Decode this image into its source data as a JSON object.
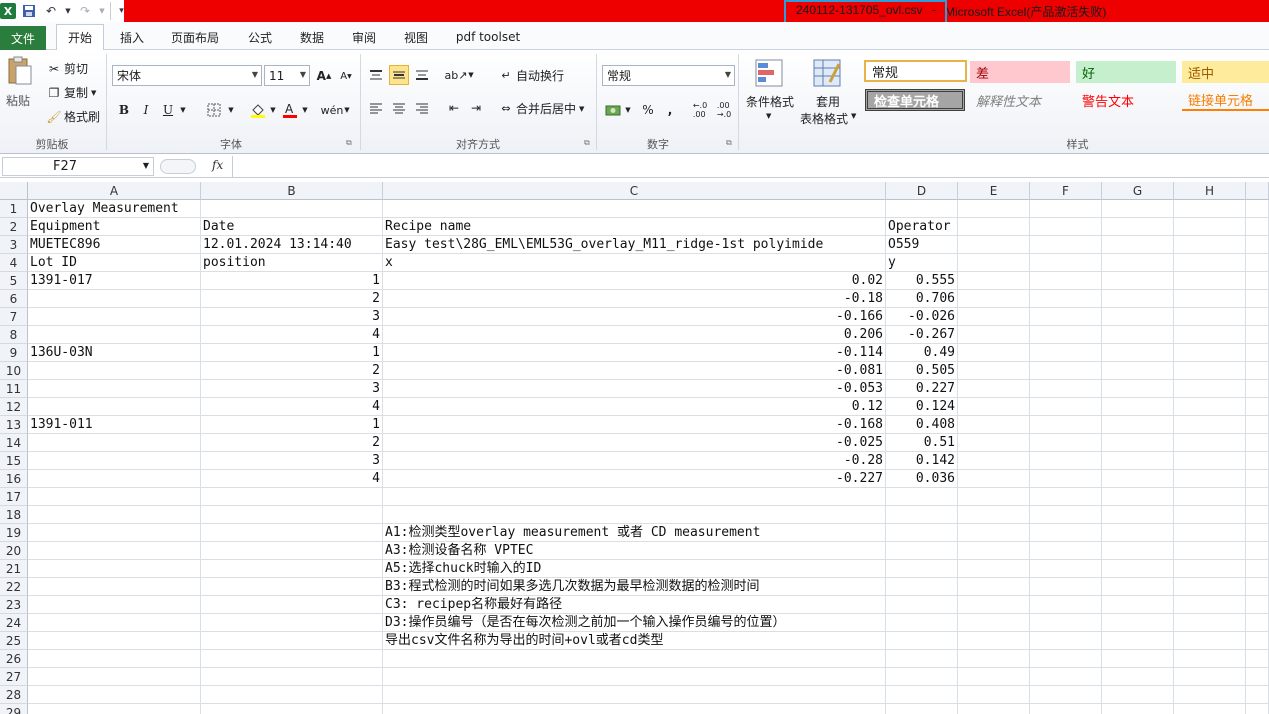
{
  "titlebar": {
    "file_name": "240112-131705_ovl.csv",
    "separator": "-",
    "app_name": "Microsoft Excel(产品激活失败)",
    "app_name_display": "Microsoft Excel(产品激活失败)",
    "qat_logo": "X"
  },
  "tabs": [
    "文件",
    "开始",
    "插入",
    "页面布局",
    "公式",
    "数据",
    "审阅",
    "视图",
    "pdf toolset"
  ],
  "ribbon": {
    "clipboard": {
      "paste": "粘贴",
      "cut": "剪切",
      "copy": "复制",
      "format_painter": "格式刷",
      "label": "剪贴板"
    },
    "font": {
      "name": "宋体",
      "size": "11",
      "bold": "B",
      "italic": "I",
      "underline": "U",
      "label": "字体"
    },
    "alignment": {
      "wrap": "自动换行",
      "merge": "合并后居中",
      "label": "对齐方式"
    },
    "number": {
      "format": "常规",
      "percent": "%",
      "comma": ",",
      "label": "数字"
    },
    "styles": {
      "conditional": "条件格式",
      "table_format_1": "套用",
      "table_format_2": "表格格式",
      "normal": "常规",
      "bad": "差",
      "good": "好",
      "neutral": "适中",
      "check_cell": "检查单元格",
      "explanatory": "解释性文本",
      "warning": "警告文本",
      "linked_cell": "链接单元格",
      "label": "样式"
    }
  },
  "formula_bar": {
    "name_box": "F27",
    "fx": "fx",
    "value": ""
  },
  "columns": [
    "A",
    "B",
    "C",
    "D",
    "E",
    "F",
    "G",
    "H"
  ],
  "rows": [
    {
      "n": "1",
      "A": "Overlay Measurement",
      "B": "",
      "C": "",
      "D": ""
    },
    {
      "n": "2",
      "A": "Equipment",
      "B": "Date",
      "C": "Recipe name",
      "D": "Operator"
    },
    {
      "n": "3",
      "A": "MUETEC896",
      "B": "12.01.2024  13:14:40",
      "C": "Easy test\\28G_EML\\EML53G_overlay_M11_ridge-1st polyimide",
      "D": "O559"
    },
    {
      "n": "4",
      "A": "Lot ID",
      "B": "position",
      "C": "x",
      "D": "y"
    },
    {
      "n": "5",
      "A": "1391-017",
      "B": "1",
      "C": "0.02",
      "D": "0.555"
    },
    {
      "n": "6",
      "A": "",
      "B": "2",
      "C": "-0.18",
      "D": "0.706"
    },
    {
      "n": "7",
      "A": "",
      "B": "3",
      "C": "-0.166",
      "D": "-0.026"
    },
    {
      "n": "8",
      "A": "",
      "B": "4",
      "C": "0.206",
      "D": "-0.267"
    },
    {
      "n": "9",
      "A": "136U-03N",
      "B": "1",
      "C": "-0.114",
      "D": "0.49"
    },
    {
      "n": "10",
      "A": "",
      "B": "2",
      "C": "-0.081",
      "D": "0.505"
    },
    {
      "n": "11",
      "A": "",
      "B": "3",
      "C": "-0.053",
      "D": "0.227"
    },
    {
      "n": "12",
      "A": "",
      "B": "4",
      "C": "0.12",
      "D": "0.124"
    },
    {
      "n": "13",
      "A": "1391-011",
      "B": "1",
      "C": "-0.168",
      "D": "0.408"
    },
    {
      "n": "14",
      "A": "",
      "B": "2",
      "C": "-0.025",
      "D": "0.51"
    },
    {
      "n": "15",
      "A": "",
      "B": "3",
      "C": "-0.28",
      "D": "0.142"
    },
    {
      "n": "16",
      "A": "",
      "B": "4",
      "C": "-0.227",
      "D": "0.036"
    },
    {
      "n": "17",
      "A": "",
      "B": "",
      "C": "",
      "D": ""
    },
    {
      "n": "18",
      "A": "",
      "B": "",
      "C": "",
      "D": ""
    },
    {
      "n": "19",
      "A": "",
      "B": "",
      "C": "A1:检测类型overlay measurement 或者 CD measurement",
      "D": ""
    },
    {
      "n": "20",
      "A": "",
      "B": "",
      "C": "A3:检测设备名称  VPTEC",
      "D": ""
    },
    {
      "n": "21",
      "A": "",
      "B": "",
      "C": "A5:选择chuck时输入的ID",
      "D": ""
    },
    {
      "n": "22",
      "A": "",
      "B": "",
      "C": "B3:程式检测的时间如果多选几次数据为最早检测数据的检测时间",
      "D": ""
    },
    {
      "n": "23",
      "A": "",
      "B": "",
      "C": "C3: recipep名称最好有路径",
      "D": ""
    },
    {
      "n": "24",
      "A": "",
      "B": "",
      "C": "D3:操作员编号（是否在每次检测之前加一个输入操作员编号的位置）",
      "D": ""
    },
    {
      "n": "25",
      "A": "",
      "B": "",
      "C": "导出csv文件名称为导出的时间+ovl或者cd类型",
      "D": ""
    },
    {
      "n": "26",
      "A": "",
      "B": "",
      "C": "",
      "D": ""
    },
    {
      "n": "27",
      "A": "",
      "B": "",
      "C": "",
      "D": ""
    },
    {
      "n": "28",
      "A": "",
      "B": "",
      "C": "",
      "D": ""
    },
    {
      "n": "29",
      "A": "",
      "B": "",
      "C": "",
      "D": ""
    }
  ],
  "colors": {
    "title_red": "#ee0000",
    "file_tab": "#2a7d3c",
    "highlight_box": "#2f9bd8"
  }
}
